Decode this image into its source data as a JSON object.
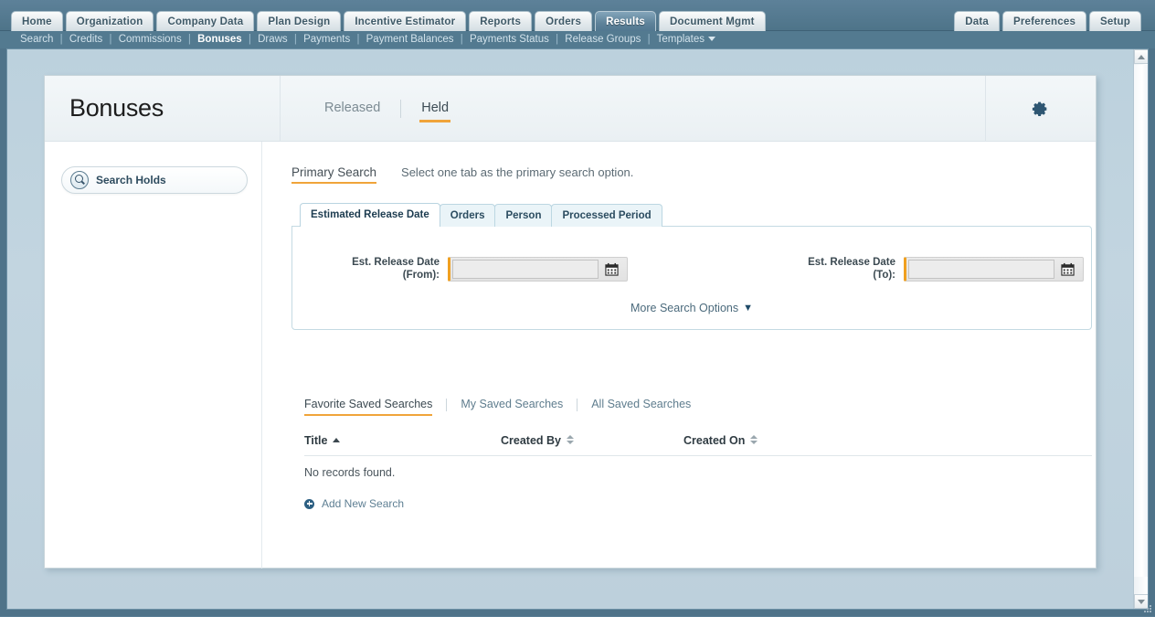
{
  "topnav": {
    "tabs": [
      {
        "label": "Home",
        "active": false
      },
      {
        "label": "Organization",
        "active": false
      },
      {
        "label": "Company Data",
        "active": false
      },
      {
        "label": "Plan Design",
        "active": false
      },
      {
        "label": "Incentive Estimator",
        "active": false
      },
      {
        "label": "Reports",
        "active": false
      },
      {
        "label": "Orders",
        "active": false
      },
      {
        "label": "Results",
        "active": true
      },
      {
        "label": "Document Mgmt",
        "active": false
      }
    ],
    "right_tabs": [
      {
        "label": "Data",
        "active": false
      },
      {
        "label": "Preferences",
        "active": false
      },
      {
        "label": "Setup",
        "active": false
      }
    ]
  },
  "subnav": {
    "items": [
      {
        "label": "Search",
        "active": false
      },
      {
        "label": "Credits",
        "active": false
      },
      {
        "label": "Commissions",
        "active": false
      },
      {
        "label": "Bonuses",
        "active": true
      },
      {
        "label": "Draws",
        "active": false
      },
      {
        "label": "Payments",
        "active": false
      },
      {
        "label": "Payment Balances",
        "active": false
      },
      {
        "label": "Payments Status",
        "active": false
      },
      {
        "label": "Release Groups",
        "active": false
      },
      {
        "label": "Templates",
        "active": false,
        "has_caret": true
      }
    ],
    "separator": "|"
  },
  "page": {
    "title": "Bonuses",
    "header_tabs": [
      {
        "label": "Released",
        "active": false
      },
      {
        "label": "Held",
        "active": true
      }
    ],
    "settings_icon": "gear-icon"
  },
  "sidebar": {
    "search_button": {
      "label": "Search Holds",
      "icon": "magnifier-icon"
    }
  },
  "primary_search": {
    "label": "Primary Search",
    "hint": "Select one tab as the primary search option.",
    "tabs": [
      {
        "label": "Estimated Release Date",
        "active": true
      },
      {
        "label": "Orders",
        "active": false
      },
      {
        "label": "Person",
        "active": false
      },
      {
        "label": "Processed Period",
        "active": false
      }
    ],
    "fields": [
      {
        "label_line1": "Est. Release Date",
        "label_line2": "(From):",
        "value": "",
        "placeholder": "",
        "calendar_icon": "calendar-icon"
      },
      {
        "label_line1": "Est. Release Date",
        "label_line2": "(To):",
        "value": "",
        "placeholder": "",
        "calendar_icon": "calendar-icon"
      }
    ],
    "more_options_label": "More Search Options",
    "more_options_caret": "⌄"
  },
  "saved_searches": {
    "tabs": [
      {
        "label": "Favorite Saved Searches",
        "active": true
      },
      {
        "label": "My Saved Searches",
        "active": false
      },
      {
        "label": "All Saved Searches",
        "active": false
      }
    ],
    "columns": [
      {
        "label": "Title",
        "sort": "asc"
      },
      {
        "label": "Created By",
        "sort": "none"
      },
      {
        "label": "Created On",
        "sort": "none"
      }
    ],
    "empty_message": "No records found.",
    "add_link": "Add New Search"
  },
  "colors": {
    "accent_orange": "#f0a43a",
    "chrome_blue": "#537a90",
    "link_blue": "#5e7f93",
    "field_marker": "#f0a020"
  }
}
